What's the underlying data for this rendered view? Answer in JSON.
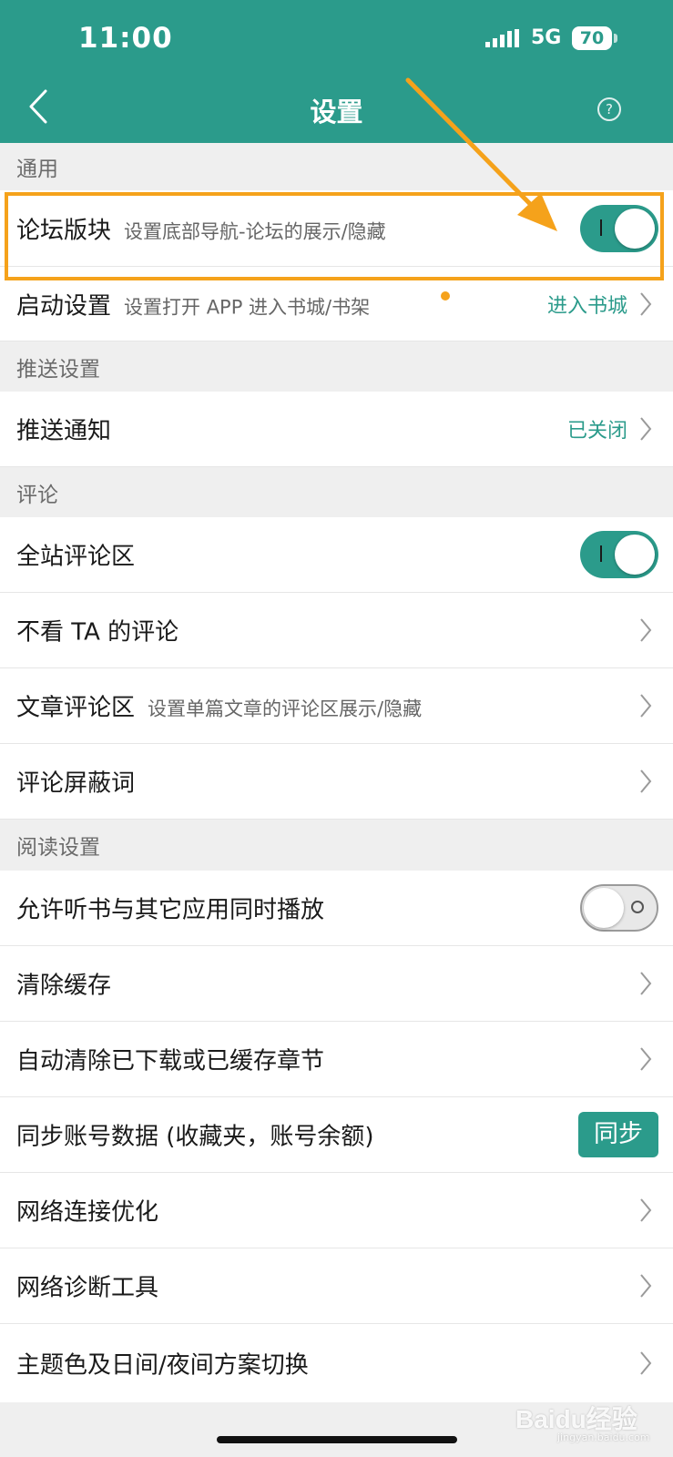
{
  "status_bar": {
    "time": "11:00",
    "network": "5G",
    "battery": "70"
  },
  "nav": {
    "title": "设置",
    "help": "?"
  },
  "sections": {
    "general": "通用",
    "push": "推送设置",
    "comments": "评论",
    "reading": "阅读设置"
  },
  "rows": {
    "forum": {
      "title": "论坛版块",
      "subtitle": "设置底部导航-论坛的展示/隐藏",
      "toggle": "on"
    },
    "startup": {
      "title": "启动设置",
      "subtitle": "设置打开 APP 进入书城/书架",
      "value": "进入书城"
    },
    "push_notice": {
      "title": "推送通知",
      "value": "已关闭"
    },
    "site_comments": {
      "title": "全站评论区",
      "toggle": "on"
    },
    "block_user": {
      "title": "不看 TA 的评论"
    },
    "article_comments": {
      "title": "文章评论区",
      "subtitle": "设置单篇文章的评论区展示/隐藏"
    },
    "blocked_words": {
      "title": "评论屏蔽词"
    },
    "mix_audio": {
      "title": "允许听书与其它应用同时播放",
      "toggle": "off"
    },
    "clear_cache": {
      "title": "清除缓存"
    },
    "auto_clear": {
      "title": "自动清除已下载或已缓存章节"
    },
    "sync": {
      "title": "同步账号数据 (收藏夹，账号余额)",
      "button": "同步"
    },
    "network_opt": {
      "title": "网络连接优化"
    },
    "network_diag": {
      "title": "网络诊断工具"
    },
    "theme": {
      "title": "主题色及日间/夜间方案切换"
    }
  },
  "watermark": {
    "brand": "Baidu经验",
    "domain": "jingyan.baidu.com"
  },
  "colors": {
    "accent": "#2b9b8b",
    "annotation": "#f5a21b",
    "section_bg": "#efefef"
  }
}
